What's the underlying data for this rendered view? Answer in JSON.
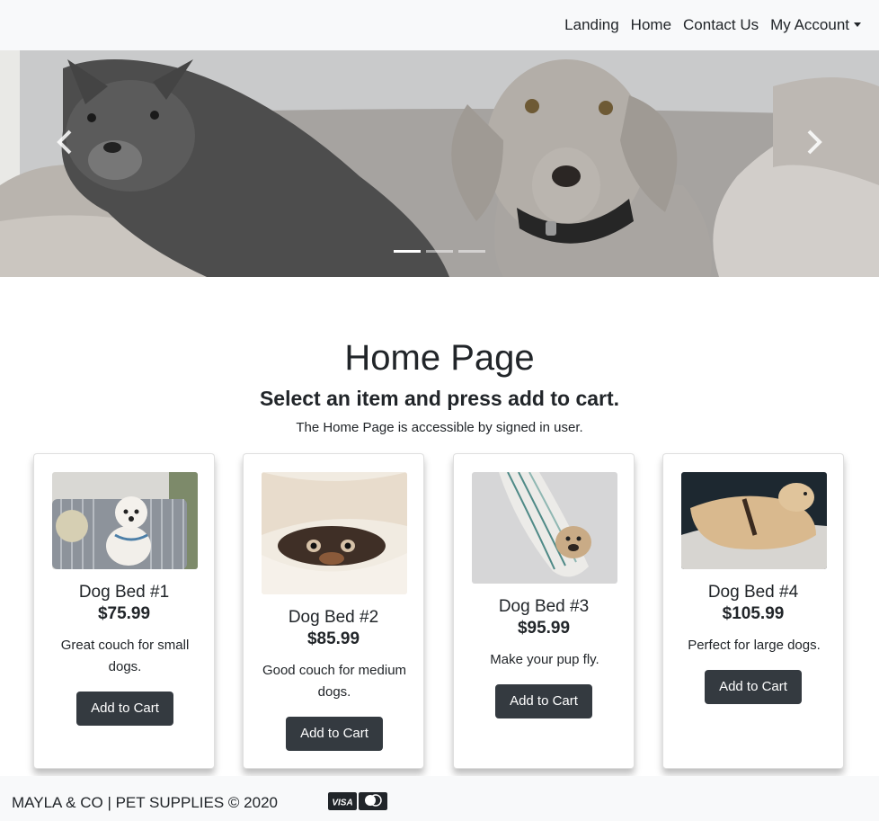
{
  "nav": {
    "links": [
      "Landing",
      "Home",
      "Contact Us",
      "My Account"
    ]
  },
  "carousel": {
    "slide_count": 3,
    "active_slide": 1
  },
  "page": {
    "title": "Home Page",
    "subtitle": "Select an item and press add to cart.",
    "note": "The Home Page is accessible by signed in user."
  },
  "products": [
    {
      "name": "Dog Bed #1",
      "price": "$75.99",
      "description": "Great couch for small dogs.",
      "button": "Add to Cart"
    },
    {
      "name": "Dog Bed #2",
      "price": "$85.99",
      "description": "Good couch for medium dogs.",
      "button": "Add to Cart"
    },
    {
      "name": "Dog Bed #3",
      "price": "$95.99",
      "description": "Make your pup fly.",
      "button": "Add to Cart"
    },
    {
      "name": "Dog Bed #4",
      "price": "$105.99",
      "description": "Perfect for large dogs.",
      "button": "Add to Cart"
    }
  ],
  "footer": {
    "text": "MAYLA & CO | PET SUPPLIES © 2020",
    "payment_icons": [
      "visa-icon",
      "mastercard-icon"
    ]
  },
  "colors": {
    "navbar_bg": "#f8f9fa",
    "button_bg": "#343a40",
    "text": "#212529"
  }
}
